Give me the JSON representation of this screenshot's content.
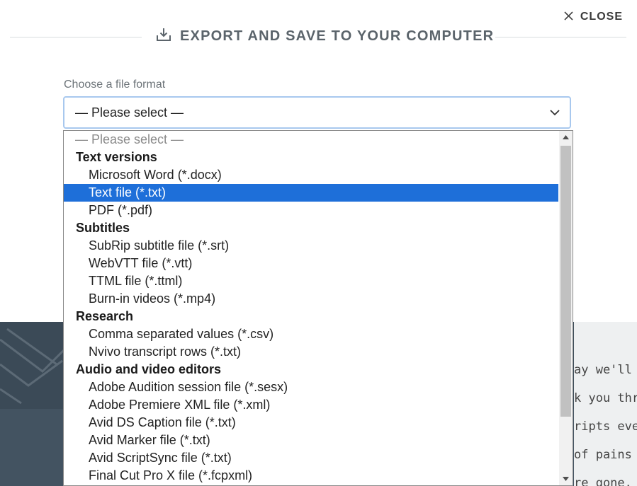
{
  "header": {
    "close_label": "CLOSE",
    "title": "EXPORT AND SAVE TO YOUR COMPUTER"
  },
  "form": {
    "label": "Choose a file format",
    "selected_value": "— Please select —"
  },
  "dropdown": {
    "items": [
      {
        "kind": "placeholder",
        "label": "— Please select —"
      },
      {
        "kind": "group",
        "label": "Text versions"
      },
      {
        "kind": "option",
        "label": "Microsoft Word (*.docx)"
      },
      {
        "kind": "option",
        "label": "Text file (*.txt)",
        "highlighted": true
      },
      {
        "kind": "option",
        "label": "PDF (*.pdf)"
      },
      {
        "kind": "group",
        "label": "Subtitles"
      },
      {
        "kind": "option",
        "label": "SubRip subtitle file (*.srt)"
      },
      {
        "kind": "option",
        "label": "WebVTT file (*.vtt)"
      },
      {
        "kind": "option",
        "label": "TTML file (*.ttml)"
      },
      {
        "kind": "option",
        "label": "Burn-in videos (*.mp4)"
      },
      {
        "kind": "group",
        "label": "Research"
      },
      {
        "kind": "option",
        "label": "Comma separated values (*.csv)"
      },
      {
        "kind": "option",
        "label": "Nvivo transcript rows (*.txt)"
      },
      {
        "kind": "group",
        "label": "Audio and video editors"
      },
      {
        "kind": "option",
        "label": "Adobe Audition session file (*.sesx)"
      },
      {
        "kind": "option",
        "label": "Adobe Premiere XML file (*.xml)"
      },
      {
        "kind": "option",
        "label": "Avid DS Caption file (*.txt)"
      },
      {
        "kind": "option",
        "label": "Avid Marker file (*.txt)"
      },
      {
        "kind": "option",
        "label": "Avid ScriptSync file (*.txt)"
      },
      {
        "kind": "option",
        "label": "Final Cut Pro X file (*.fcpxml)"
      }
    ]
  },
  "background": {
    "typed_lines": [
      "ay we'll",
      "k you thr",
      "ripts eve",
      " of pains",
      "re gone."
    ]
  },
  "colors": {
    "highlight": "#1e6fd9",
    "focus_border": "#a8c8ee"
  },
  "icons": {
    "close": "close-icon",
    "download": "download-icon",
    "chevron": "chevron-down-icon"
  }
}
